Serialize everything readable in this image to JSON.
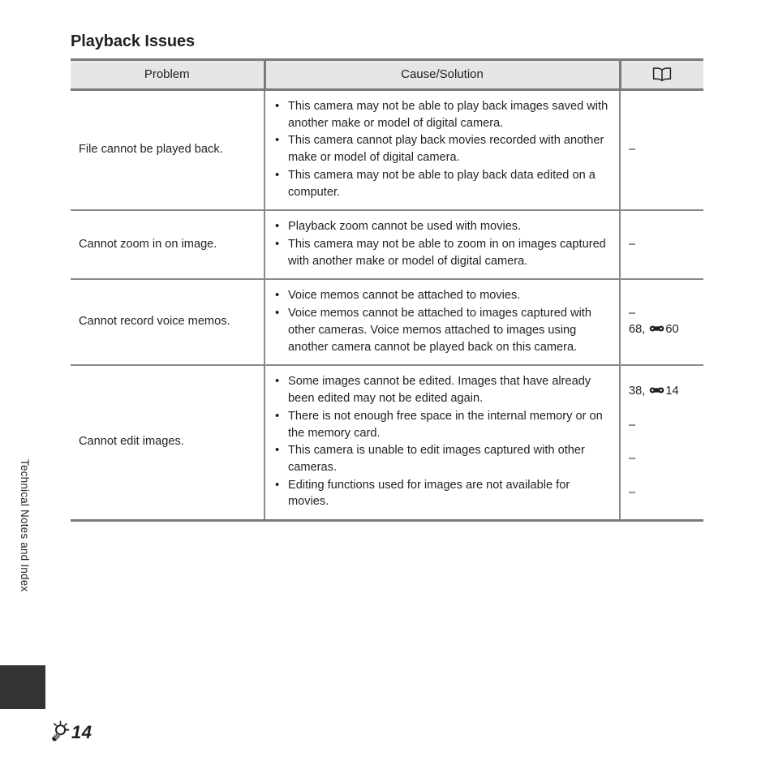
{
  "page": {
    "title": "Playback Issues",
    "side_label": "Technical Notes and Index",
    "folio": "14",
    "folio_icon": "tips-bulb-icon",
    "tab_color": "#333333"
  },
  "table": {
    "headers": {
      "problem": "Problem",
      "cause": "Cause/Solution",
      "reference_icon": "open-book-icon"
    },
    "rows": [
      {
        "problem": "File cannot be played back.",
        "causes": [
          "This camera may not be able to play back images saved with another make or model of digital camera.",
          "This camera cannot play back movies recorded with another make or model of digital camera.",
          "This camera may not be able to play back data edited on a computer."
        ],
        "references": [
          "–"
        ]
      },
      {
        "problem": "Cannot zoom in on image.",
        "causes": [
          "Playback zoom cannot be used with movies.",
          "This camera may not be able to zoom in on images captured with another make or model of digital camera."
        ],
        "references": [
          "–"
        ]
      },
      {
        "problem": "Cannot record voice memos.",
        "causes": [
          "Voice memos cannot be attached to movies.",
          "Voice memos cannot be attached to images captured with other cameras. Voice memos attached to images using another camera cannot be played back on this camera."
        ],
        "references": [
          "–",
          "68,  60"
        ]
      },
      {
        "problem": "Cannot edit images.",
        "causes": [
          "Some images cannot be edited. Images that have already been edited may not be edited again.",
          "There is not enough free space in the internal memory or on the memory card.",
          "This camera is unable to edit images captured with other cameras.",
          "Editing functions used for images are not available for movies."
        ],
        "references": [
          "38,  14",
          "–",
          "–",
          "–"
        ]
      }
    ]
  },
  "colors": {
    "text": "#231f20",
    "header_fill": "#e6e6e6",
    "rule": "#7a7a7a"
  }
}
